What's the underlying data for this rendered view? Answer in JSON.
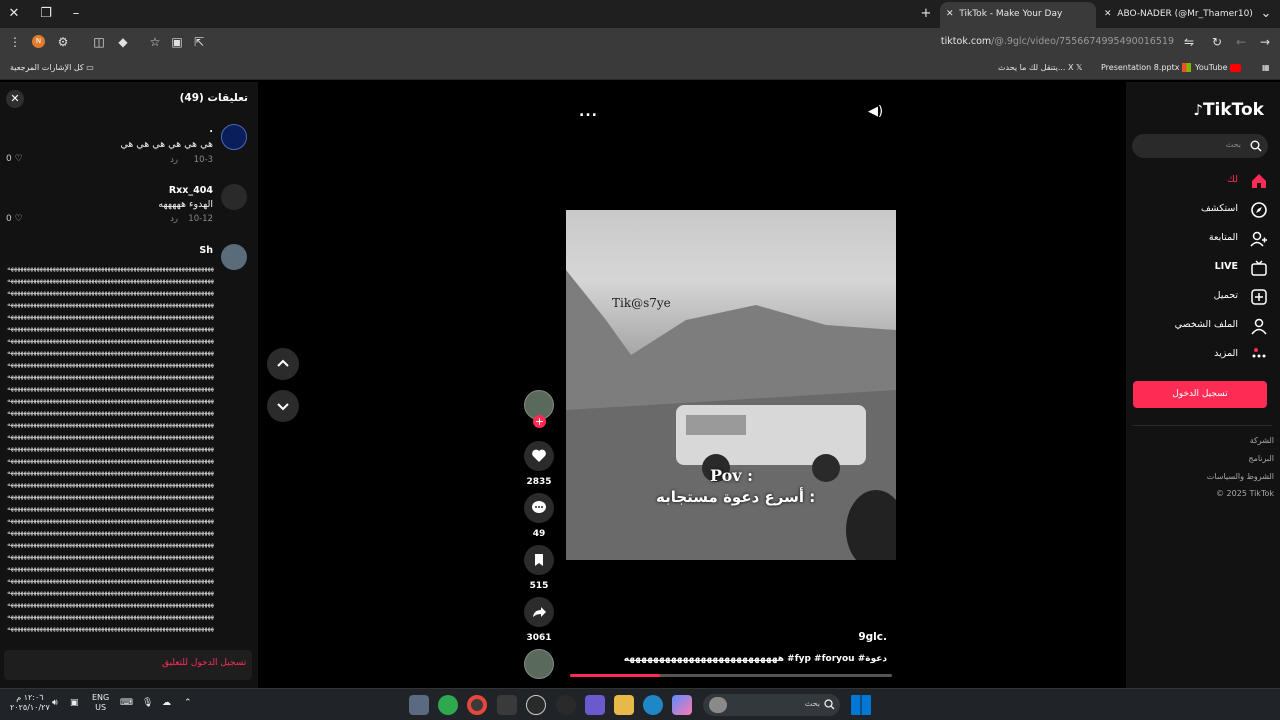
{
  "browser": {
    "tabs": [
      {
        "title": "TikTok - Make Your Day",
        "active": true
      },
      {
        "title": "ABO-NADER (@Mr_Thamer10)",
        "active": false
      }
    ],
    "url_host": "tiktok.com",
    "url_path": "/@.9glc/video/7556674995490016519",
    "profile_letter": "N",
    "bookmarks": {
      "all_bookmarks": "كل الإشارات المرجعية",
      "items": [
        "YouTube",
        "Presentation 8.pptx",
        "يتنقل لك ما يحدث... X"
      ]
    }
  },
  "comments": {
    "title": "تعليقات (49)",
    "list": [
      {
        "user": ".",
        "text": "هي هي هي هي هي هي",
        "date": "10-3",
        "reply": "رد",
        "likes": "0"
      },
      {
        "user": "Rxx_404",
        "text": "الهدوء هههههه",
        "date": "10-12",
        "reply": "رد",
        "likes": "0"
      },
      {
        "user": "Sh",
        "long_line": "ههههههههههههههههههههههههههههههههههههههههههههههههههههههههههههههههههههههه"
      }
    ],
    "login_to_comment": "تسجيل الدخول للتعليق"
  },
  "video": {
    "overlay_watermark": "Tik@s7ye",
    "overlay_pov": "Pov :",
    "overlay_caption": "أسرع دعوة مستجابه :",
    "more_menu": "...",
    "likes": "2835",
    "comments_count": "49",
    "saves": "515",
    "shares": "3061",
    "author": "9glc.",
    "description": "ههههههههههههههههههههههههههه #fyp #foryou #دعوة",
    "progress": 0.28
  },
  "sidebar": {
    "logo": "TikTok",
    "search_placeholder": "بحث",
    "nav": [
      {
        "label": "لك",
        "icon": "home-icon",
        "active": true
      },
      {
        "label": "استكشف",
        "icon": "compass-icon"
      },
      {
        "label": "المتابعة",
        "icon": "following-icon"
      },
      {
        "label": "LIVE",
        "icon": "live-icon"
      },
      {
        "label": "تحميل",
        "icon": "upload-icon"
      },
      {
        "label": "الملف الشخصي",
        "icon": "profile-icon"
      },
      {
        "label": "المزيد",
        "icon": "more-icon"
      }
    ],
    "login_button": "تسجيل الدخول",
    "footer": [
      "الشركة",
      "البرنامج",
      "الشروط والسياسات",
      "© 2025 TikTok"
    ]
  },
  "taskbar": {
    "search_placeholder": "بحث",
    "lang_top": "ENG",
    "lang_bottom": "US",
    "time": "١٢:٠٦ م",
    "date": "٢٠٢٥/١٠/٢٧"
  },
  "colors": {
    "accent": "#fe2c55",
    "panel": "#121212"
  }
}
